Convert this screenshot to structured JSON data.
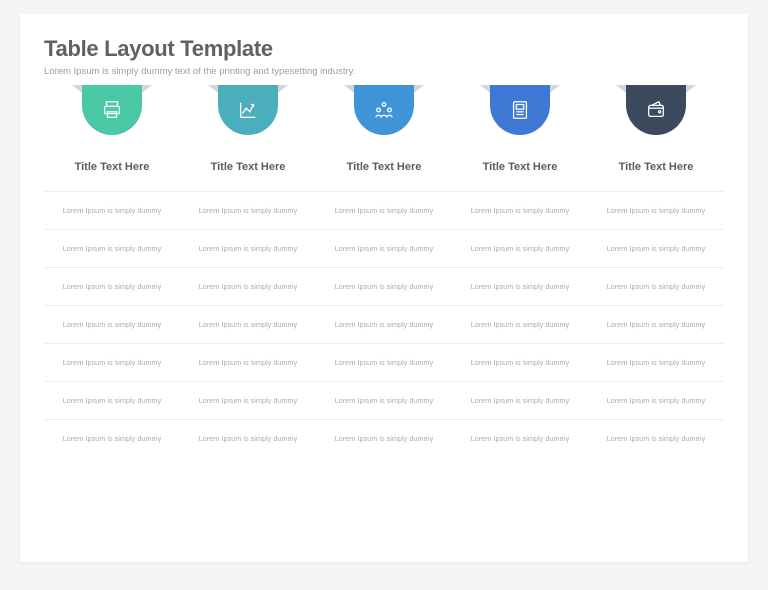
{
  "header": {
    "title": "Table Layout Template",
    "subtitle": "Lorem Ipsum is simply dummy text of the printing and typesetting industry."
  },
  "columns": [
    {
      "icon": "printer-icon",
      "color": "#4bc9a6",
      "title": "Title Text Here",
      "rows": [
        "Lorem Ipsum is simply dummy",
        "Lorem Ipsum is simply dummy",
        "Lorem Ipsum is simply dummy",
        "Lorem Ipsum is simply dummy",
        "Lorem Ipsum is simply dummy",
        "Lorem Ipsum is simply dummy",
        "Lorem Ipsum is simply dummy"
      ]
    },
    {
      "icon": "chart-icon",
      "color": "#4aaebc",
      "title": "Title Text Here",
      "rows": [
        "Lorem Ipsum is simply dummy",
        "Lorem Ipsum is simply dummy",
        "Lorem Ipsum is simply dummy",
        "Lorem Ipsum is simply dummy",
        "Lorem Ipsum is simply dummy",
        "Lorem Ipsum is simply dummy",
        "Lorem Ipsum is simply dummy"
      ]
    },
    {
      "icon": "people-icon",
      "color": "#3e94d6",
      "title": "Title Text Here",
      "rows": [
        "Lorem Ipsum is simply dummy",
        "Lorem Ipsum is simply dummy",
        "Lorem Ipsum is simply dummy",
        "Lorem Ipsum is simply dummy",
        "Lorem Ipsum is simply dummy",
        "Lorem Ipsum is simply dummy",
        "Lorem Ipsum is simply dummy"
      ]
    },
    {
      "icon": "book-icon",
      "color": "#3f78d4",
      "title": "Title Text Here",
      "rows": [
        "Lorem Ipsum is simply dummy",
        "Lorem Ipsum is simply dummy",
        "Lorem Ipsum is simply dummy",
        "Lorem Ipsum is simply dummy",
        "Lorem Ipsum is simply dummy",
        "Lorem Ipsum is simply dummy",
        "Lorem Ipsum is simply dummy"
      ]
    },
    {
      "icon": "wallet-icon",
      "color": "#3b4a5d",
      "title": "Title Text Here",
      "rows": [
        "Lorem Ipsum is simply dummy",
        "Lorem Ipsum is simply dummy",
        "Lorem Ipsum is simply dummy",
        "Lorem Ipsum is simply dummy",
        "Lorem Ipsum is simply dummy",
        "Lorem Ipsum is simply dummy",
        "Lorem Ipsum is simply dummy"
      ]
    }
  ]
}
